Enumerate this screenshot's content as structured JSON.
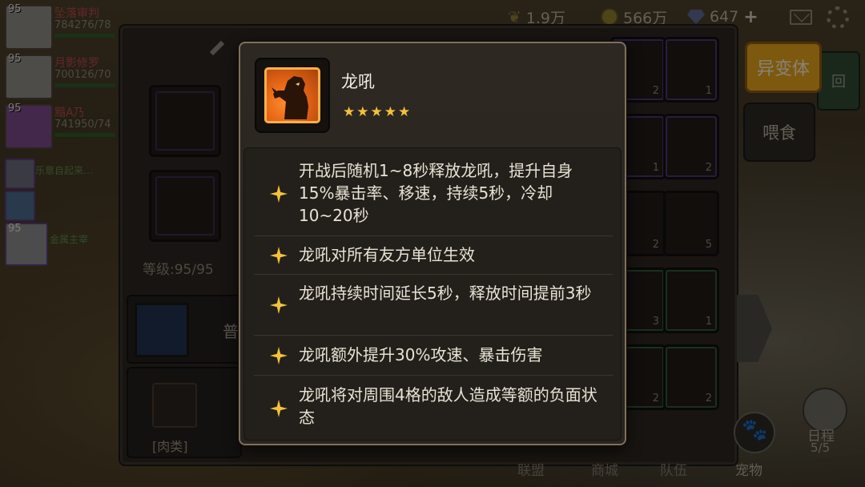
{
  "resources": {
    "wheat_amount": "1.9万",
    "gold_amount": "566万",
    "gem_amount": "647",
    "add_symbol": "+"
  },
  "roster": [
    {
      "level": "95",
      "name": "坠落审判",
      "hp": "784276/78"
    },
    {
      "level": "95",
      "name": "月影修罗",
      "hp": "700126/70"
    },
    {
      "level": "95",
      "name": "黯A乃",
      "hp": "741950/74"
    }
  ],
  "mini_roster": [
    {
      "name": "乐意自起来…"
    },
    {
      "level": "95",
      "name": "金属主宰"
    }
  ],
  "hero_panel": {
    "level_text": "等级:95/95",
    "book_label": "普",
    "meat_label": "[肉类]"
  },
  "inventory_counts": [
    "2",
    "1",
    "1",
    "2",
    "2",
    "5",
    "3",
    "1",
    "2",
    "2"
  ],
  "right_buttons": {
    "mutant": "异变体",
    "back": "回",
    "feed": "喂食"
  },
  "bottom_nav": {
    "alliance": "联盟",
    "shop": "商城",
    "team": "队伍",
    "pet": "宠物",
    "schedule": "日程",
    "schedule_count": "5/5"
  },
  "tooltip": {
    "skill_name": "龙吼",
    "stars": "★★★★★",
    "effects": [
      "开战后随机1~8秒释放龙吼，提升自身15%暴击率、移速，持续5秒，冷却10~20秒",
      "龙吼对所有友方单位生效",
      "龙吼持续时间延长5秒，释放时间提前3秒",
      "龙吼额外提升30%攻速、暴击伤害",
      "龙吼将对周围4格的敌人造成等额的负面状态"
    ]
  },
  "colors": {
    "accent_gold": "#f1c23c",
    "skill_orange": "#e46516",
    "mutant_button": "#e4a21e"
  }
}
